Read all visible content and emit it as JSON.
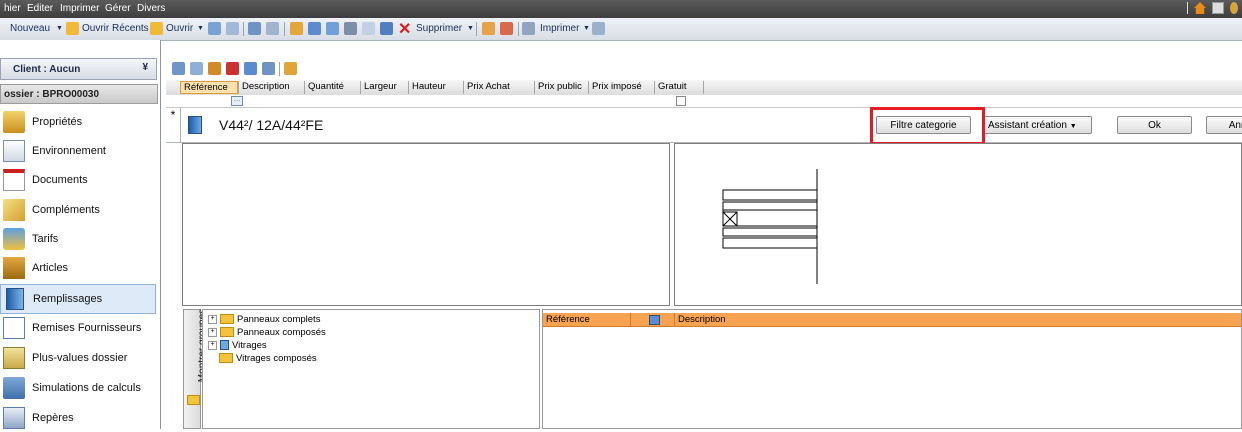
{
  "menu": [
    "hier",
    "Editer",
    "Imprimer",
    "Gérer",
    "Divers"
  ],
  "toolbar": {
    "nouveau": "Nouveau",
    "ouvrir_recents": "Ouvrir Récents",
    "ouvrir": "Ouvrir",
    "supprimer": "Supprimer",
    "imprimer": "Imprimer"
  },
  "sidebar": {
    "client": "Client : Aucun",
    "dossier": "ossier : BPRO00030",
    "items": [
      {
        "label": "Propriétés",
        "icon": "properties-icon"
      },
      {
        "label": "Environnement",
        "icon": "environment-icon"
      },
      {
        "label": "Documents",
        "icon": "documents-icon"
      },
      {
        "label": "Compléments",
        "icon": "complements-icon"
      },
      {
        "label": "Tarifs",
        "icon": "tariffs-icon"
      },
      {
        "label": "Articles",
        "icon": "articles-icon"
      },
      {
        "label": "Remplissages",
        "icon": "fillings-icon",
        "selected": true
      },
      {
        "label": "Remises Fournisseurs",
        "icon": "supplier-discounts-icon"
      },
      {
        "label": "Plus-values dossier",
        "icon": "surplus-icon"
      },
      {
        "label": "Simulations de calculs",
        "icon": "calculator-icon"
      },
      {
        "label": "Repères",
        "icon": "markers-icon"
      }
    ]
  },
  "grid": {
    "columns": [
      "Référence",
      "Description",
      "Quantité",
      "Largeur",
      "Hauteur",
      "Prix Achat",
      "Prix public",
      "Prix imposé",
      "Gratuit"
    ],
    "row_marker": "*",
    "product_name": "V44²/ 12A/44²FE"
  },
  "buttons": {
    "filtre": "Filtre categorie",
    "assistant": "Assistant création",
    "ok": "Ok",
    "annuler": "Annuler"
  },
  "tree": {
    "group_label": "Montrer groupes",
    "nodes": [
      "Panneaux complets",
      "Panneaux composés",
      "Vitrages",
      "Vitrages composés"
    ]
  },
  "list": {
    "columns": [
      "Référence",
      "Description"
    ]
  },
  "colors": {
    "highlight": "#e51c23",
    "list_header": "#f7a352",
    "selected_nav": "#dfeaf8"
  }
}
